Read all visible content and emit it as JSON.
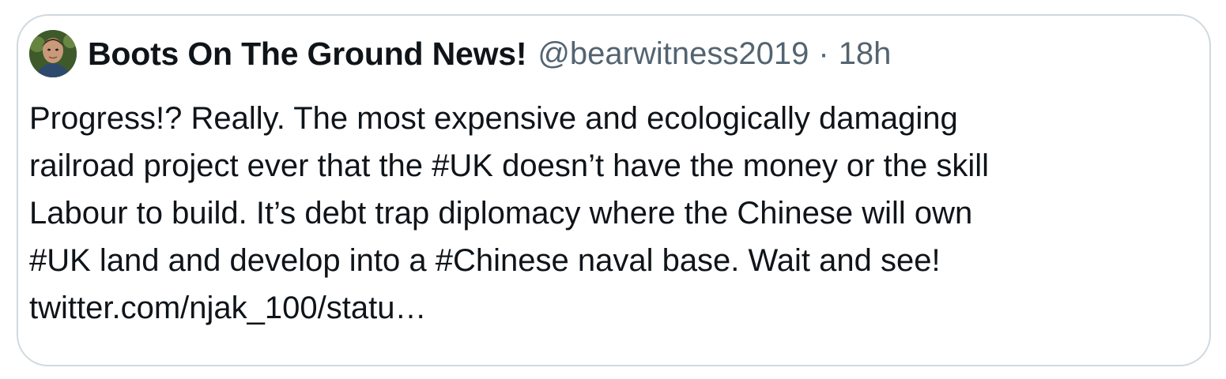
{
  "tweet": {
    "author": {
      "display_name": "Boots On The Ground News!",
      "handle": "@bearwitness2019",
      "separator": "·",
      "timestamp": "18h",
      "avatar_icon": "profile-photo"
    },
    "text_lines": [
      "Progress!? Really. The most expensive and ecologically damaging",
      "railroad project ever that the #UK doesn’t have the money or the skill",
      "Labour to build. It’s debt trap diplomacy where the Chinese will own",
      "#UK land and develop into a #Chinese naval base. Wait and see!",
      "twitter.com/njak_100/statu…"
    ],
    "colors": {
      "border": "#cfd9de",
      "text": "#0f1419",
      "secondary": "#536471"
    }
  }
}
